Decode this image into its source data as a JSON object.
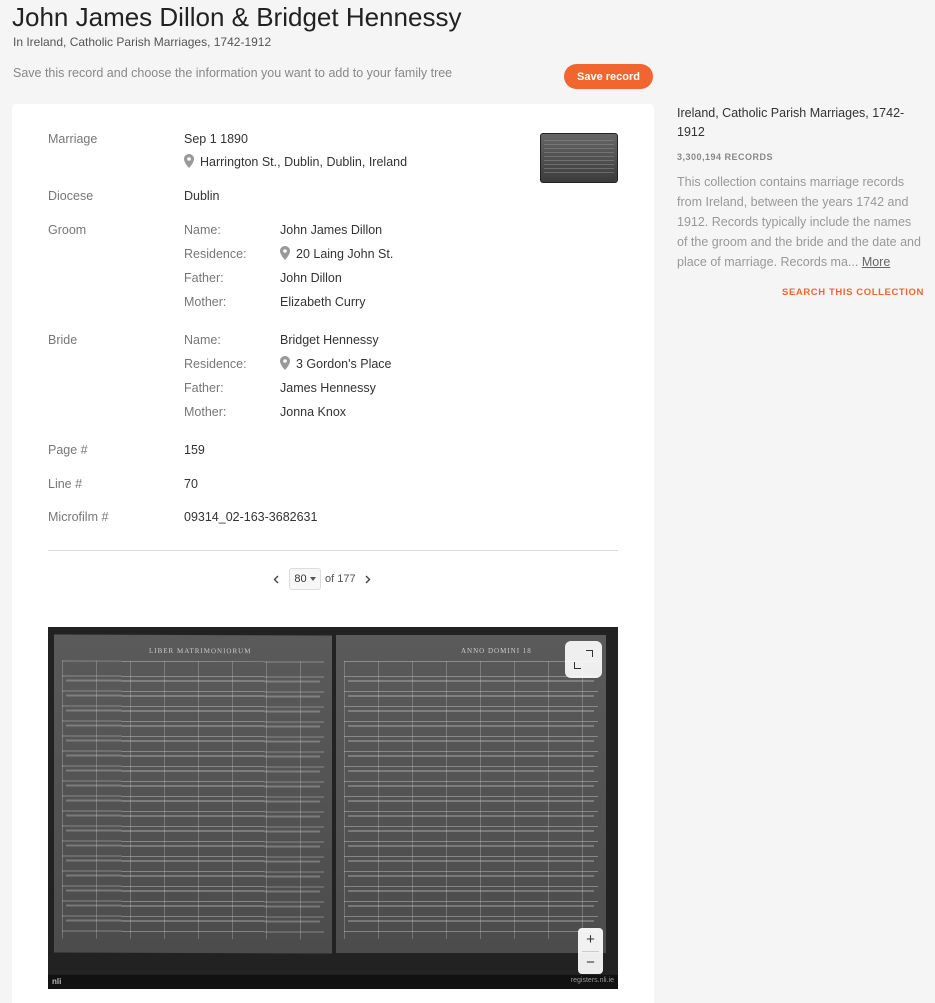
{
  "header": {
    "title": "John James Dillon & Bridget Hennessy",
    "subtitle": "In Ireland, Catholic Parish Marriages, 1742-1912",
    "save_hint": "Save this record and choose the information you want to add to your family tree",
    "save_label": "Save record"
  },
  "record": {
    "marriage_label": "Marriage",
    "marriage_date": "Sep 1 1890",
    "marriage_place": "Harrington St., Dublin, Dublin, Ireland",
    "diocese_label": "Diocese",
    "diocese": "Dublin",
    "groom_label": "Groom",
    "groom": {
      "name_label": "Name:",
      "name": "John James Dillon",
      "residence_label": "Residence:",
      "residence": "20 Laing John St.",
      "father_label": "Father:",
      "father": "John Dillon",
      "mother_label": "Mother:",
      "mother": "Elizabeth Curry"
    },
    "bride_label": "Bride",
    "bride": {
      "name_label": "Name:",
      "name": "Bridget Hennessy",
      "residence_label": "Residence:",
      "residence": "3 Gordon's Place",
      "father_label": "Father:",
      "father": "James Hennessy",
      "mother_label": "Mother:",
      "mother": "Jonna Knox"
    },
    "page_label": "Page #",
    "page": "159",
    "line_label": "Line #",
    "line": "70",
    "microfilm_label": "Microfilm #",
    "microfilm": "09314_02-163-3682631"
  },
  "pager": {
    "current": "80",
    "of_text": "of 177"
  },
  "viewer": {
    "left_heading": "LIBER MATRIMONIORUM",
    "right_heading": "ANNO DOMINI 18",
    "logo": "nli",
    "footer_site": "registers.nli.ie",
    "zoom_in": "+",
    "zoom_out": "−"
  },
  "sidebar": {
    "collection_title": "Ireland, Catholic Parish Marriages, 1742-1912",
    "record_count": "3,300,194 RECORDS",
    "description": "This collection contains marriage records from Ireland, between the years 1742 and 1912. Records typically include the names of the groom and the bride and the date and place of marriage. Records ma...",
    "more_label": "More",
    "search_label": "SEARCH THIS COLLECTION"
  },
  "colors": {
    "accent": "#f0662e",
    "background": "#f5f5f5"
  }
}
